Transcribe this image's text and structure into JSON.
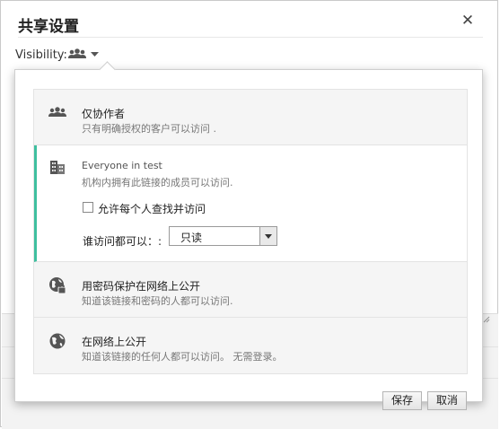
{
  "dialog": {
    "title": "共享设置",
    "close_glyph": "✕",
    "close_icon": "close-icon"
  },
  "visibility": {
    "label": "Visibility:",
    "icon": "people-icon",
    "dropdown_icon": "caret-down-icon"
  },
  "options": [
    {
      "icon": "people-icon",
      "title": "仅协作者",
      "description": "只有明确授权的客户可以访问 ."
    },
    {
      "icon": "building-icon",
      "title": "Everyone in test",
      "description": "机构内拥有此链接的成员可以访问.",
      "selected": true,
      "checkbox_label": "允许每个人查找并访问",
      "checkbox_checked": false,
      "access_label": "谁访问都可以：:",
      "access_value": "只读"
    },
    {
      "icon": "globe-lock-icon",
      "title": "用密码保护在网络上公开",
      "description": "知道该链接和密码的人都可以访问."
    },
    {
      "icon": "globe-icon",
      "title": "在网络上公开",
      "description": "知道该链接的任何人都可以访问。 无需登录。"
    }
  ],
  "footer": {
    "save_label": "保存",
    "cancel_label": "取消"
  },
  "colors": {
    "accent": "#3fbf9f",
    "panel_border": "#cfcfcf",
    "option_bg": "#f5f5f5"
  }
}
